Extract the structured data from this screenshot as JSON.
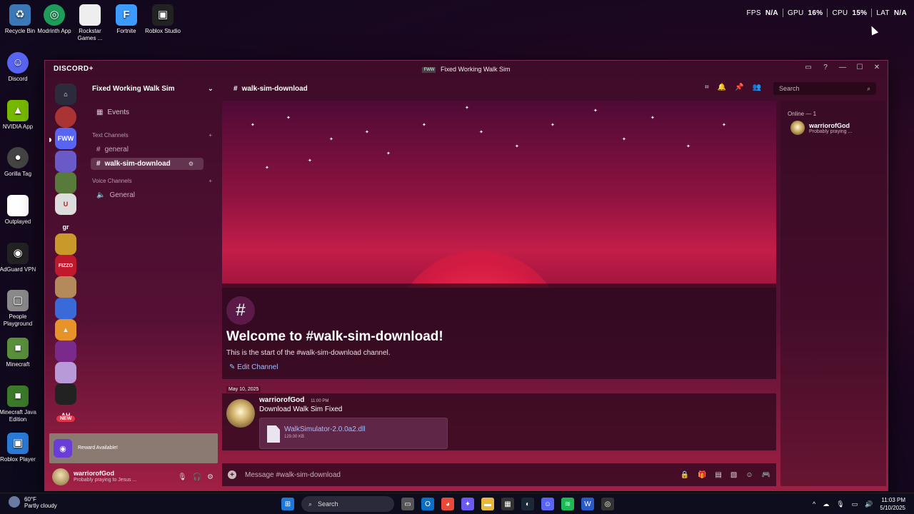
{
  "desktop": {
    "icons": [
      {
        "label": "Recycle Bin",
        "glyph": "♻",
        "color": "#3a78b8"
      },
      {
        "label": "Modrinth App",
        "glyph": "◎",
        "color": "#1e9c5a"
      },
      {
        "label": "Rockstar Games ...",
        "glyph": "",
        "color": "#eeeeee"
      },
      {
        "label": "Fortnite",
        "glyph": "F",
        "color": "#3b9bff"
      },
      {
        "label": "Roblox Studio",
        "glyph": "▣",
        "color": "#222222"
      },
      {
        "label": "Discord",
        "glyph": "☺",
        "color": "#5865f2"
      },
      {
        "label": "NVIDIA App",
        "glyph": "▲",
        "color": "#76b900"
      },
      {
        "label": "Gorilla Tag",
        "glyph": "●",
        "color": "#444444"
      },
      {
        "label": "Outplayed",
        "glyph": "",
        "color": "#ffffff"
      },
      {
        "label": "AdGuard VPN",
        "glyph": "◉",
        "color": "#222222"
      },
      {
        "label": "People Playground",
        "glyph": "▢",
        "color": "#8a8a8a"
      },
      {
        "label": "Minecraft",
        "glyph": "■",
        "color": "#5a8f3c"
      },
      {
        "label": "Minecraft Java Edition",
        "glyph": "■",
        "color": "#3c7a2a"
      },
      {
        "label": "Roblox Player",
        "glyph": "▣",
        "color": "#2a7bd6"
      }
    ],
    "overlay": {
      "fps_label": "FPS",
      "fps_value": "N/A",
      "gpu_label": "GPU",
      "gpu_value": "16%",
      "cpu_label": "CPU",
      "cpu_value": "15%",
      "lat_label": "LAT",
      "lat_value": "N/A"
    }
  },
  "window": {
    "logo": "DISCORD+",
    "title_icon": "FWW",
    "title": "Fixed Working Walk Sim",
    "controls": [
      "▭",
      "?",
      "—",
      "☐",
      "✕"
    ]
  },
  "rail": {
    "new_badge": "NEW"
  },
  "sidebar": {
    "guild_name": "Fixed Working Walk Sim",
    "events": "Events",
    "text_category": "Text Channels",
    "text_channels": [
      "general",
      "walk-sim-download"
    ],
    "voice_category": "Voice Channels",
    "voice_channels": [
      "General"
    ]
  },
  "reward": {
    "text": "Reward Available!"
  },
  "user": {
    "name": "warriorofGod",
    "status": "Probably praying to Jesus ..."
  },
  "channel": {
    "name": "walk-sim-download",
    "search_placeholder": "Search"
  },
  "welcome": {
    "title": "Welcome to #walk-sim-download!",
    "subtitle": "This is the start of the #walk-sim-download channel.",
    "edit": "Edit Channel"
  },
  "message": {
    "date": "May 10, 2025",
    "author": "warriorofGod",
    "time": "11:00 PM",
    "text": "Download Walk Sim Fixed",
    "file_name": "WalkSimulator-2.0.0a2.dll",
    "file_size": "129.00 KB"
  },
  "composer": {
    "placeholder": "Message #walk-sim-download"
  },
  "members": {
    "header": "Online — 1",
    "name": "warriorofGod",
    "status": "Probably praying ..."
  },
  "taskbar": {
    "temp": "60°F",
    "weather": "Partly cloudy",
    "search": "Search",
    "time": "11:03 PM",
    "date": "5/10/2025"
  }
}
